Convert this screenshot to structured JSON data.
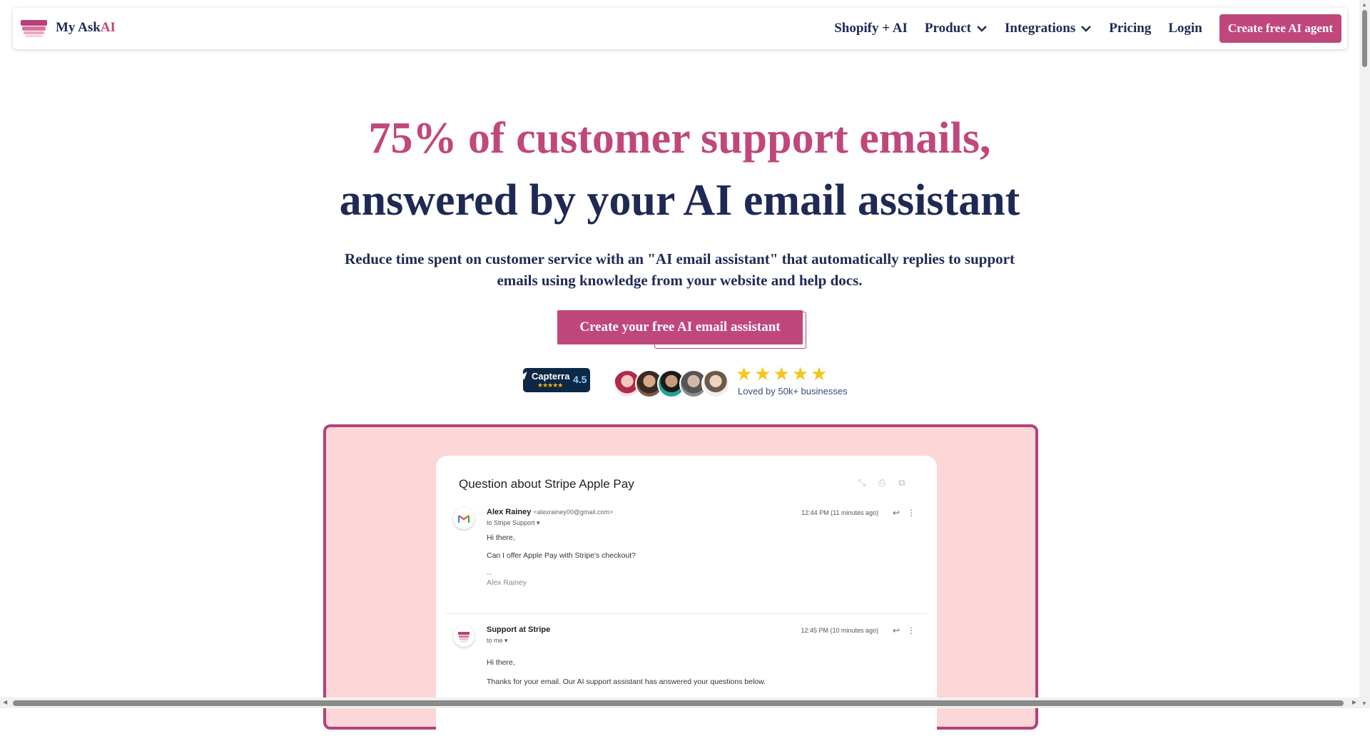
{
  "nav": {
    "brand_prefix": "My Ask",
    "brand_suffix": "AI",
    "links": [
      {
        "label": "Shopify + AI",
        "dropdown": false
      },
      {
        "label": "Product",
        "dropdown": true
      },
      {
        "label": "Integrations",
        "dropdown": true
      },
      {
        "label": "Pricing",
        "dropdown": false
      },
      {
        "label": "Login",
        "dropdown": false
      }
    ],
    "cta_label": "Create free AI agent"
  },
  "hero": {
    "headline_line1": "75% of customer support emails,",
    "headline_line2": "answered by your AI email assistant",
    "subtitle": "Reduce time spent on customer service with an \"AI email assistant\" that automatically replies to support emails using knowledge from your website and help docs.",
    "cta_label": "Create your free AI email assistant"
  },
  "social_proof": {
    "capterra_name": "Capterra",
    "capterra_stars": "★★★★★",
    "capterra_score": "4.5",
    "rating_stars": "★★★★★",
    "loved_text": "Loved by 50k+ businesses"
  },
  "demo_email": {
    "subject": "Question about Stripe Apple Pay",
    "messages": [
      {
        "sender": "Alex Rainey",
        "address": "<alexrainey00@gmail.com>",
        "to": "to Stripe Support ▾",
        "time": "12:44 PM (11 minutes ago)",
        "body": [
          "Hi there,",
          "Can I offer Apple Pay with Stripe's checkout?",
          "--",
          "Alex Rainey"
        ]
      },
      {
        "sender": "Support at Stripe",
        "address": "",
        "to": "to me ▾",
        "time": "12:45 PM (10 minutes ago)",
        "body": [
          "Hi there,",
          "Thanks for your email. Our AI support assistant has answered your questions below."
        ]
      }
    ]
  },
  "colors": {
    "brand_pink": "#c0477c",
    "navy": "#1e2a55",
    "frame_bg": "#fdd7d7"
  }
}
